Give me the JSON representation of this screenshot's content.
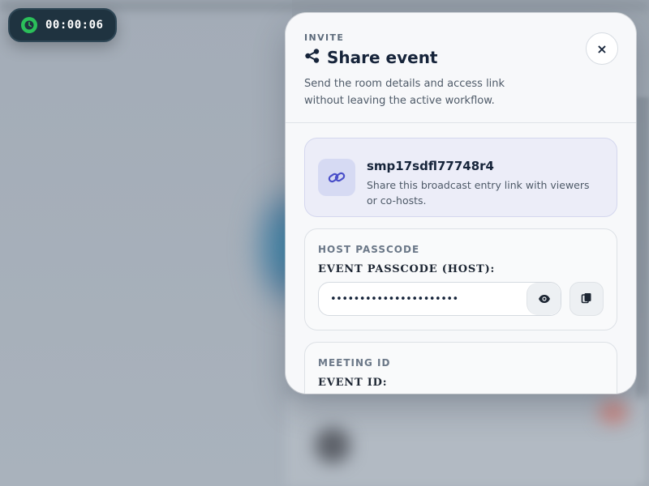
{
  "timer": {
    "elapsed": "00:00:06",
    "icon": "clock-icon"
  },
  "modal": {
    "eyebrow": "INVITE",
    "title": "Share event",
    "title_icon": "share-icon",
    "description": "Send the room details and access link without leaving the active workflow.",
    "close_label": "×",
    "link": {
      "icon": "link-icon",
      "id": "smp17sdfl77748r4",
      "description": "Share this broadcast entry link with viewers or co-hosts."
    },
    "host_passcode": {
      "section_title": "HOST PASSCODE",
      "label": "EVENT PASSCODE (HOST):",
      "value": "••••••••••••••••••••••",
      "reveal_icon": "eye-icon",
      "copy_icon": "copy-icon"
    },
    "meeting_id": {
      "section_title": "MEETING ID",
      "label": "EVENT ID:"
    }
  },
  "colors": {
    "accent_green": "#2bbf5a",
    "title_dark": "#16243a",
    "link_card_bg": "#ecedf8",
    "link_icon": "#4a4fc9"
  }
}
